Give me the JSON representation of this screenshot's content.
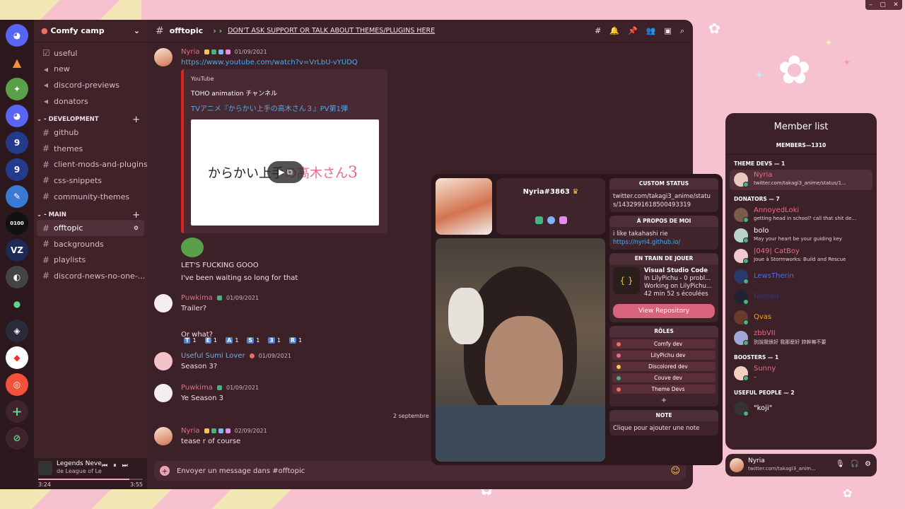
{
  "guild": {
    "name": "Comfy camp"
  },
  "channels_top": [
    "useful",
    "new",
    "discord-previews",
    "donators"
  ],
  "category_dev": "- DEVELOPMENT",
  "channels_dev": [
    "github",
    "themes",
    "client-mods-and-plugins",
    "css-snippets",
    "community-themes"
  ],
  "category_main": "- MAIN",
  "channels_main": [
    "offtopic",
    "backgrounds",
    "playlists",
    "discord-news-no-one-..."
  ],
  "player": {
    "title": "Legends Neve",
    "artist": "de League of Le",
    "elapsed": "3:24",
    "total": "3:55",
    "progress": 0.87
  },
  "chat": {
    "channel": "offtopic",
    "topic": "DON'T ASK SUPPORT OR TALK ABOUT THEMES/PLUGINS HERE",
    "input_placeholder": "Envoyer un message dans #offtopic",
    "date_divider": "2 septembre 20"
  },
  "messages": [
    {
      "author": "Nyria",
      "color": "#e86a8a",
      "time": "01/09/2021",
      "text": "https://www.youtube.com/watch?v=VrLbU-vYUDQ"
    },
    {
      "author": "",
      "color": "#ffffff",
      "time": "",
      "text": "LET'S FUCKING GOOO"
    },
    {
      "author": "",
      "color": "#ffffff",
      "time": "",
      "text": "I've been waiting so long for that"
    },
    {
      "author": "Puwkima",
      "color": "#e86a8a",
      "time": "01/09/2021",
      "text": "Trailer?"
    },
    {
      "author": "",
      "color": "#ffffff",
      "time": "",
      "text": "Or what?"
    },
    {
      "author": "Useful Sumi Lover",
      "color": "#6ab0e8",
      "time": "01/09/2021",
      "text": "Season 3?"
    },
    {
      "author": "Puwkima",
      "color": "#e86a8a",
      "time": "01/09/2021",
      "text": "Ye Season 3"
    },
    {
      "author": "Nyria",
      "color": "#e86a8a",
      "time": "02/09/2021",
      "text": "tease r of course"
    }
  ],
  "embed": {
    "provider": "YouTube",
    "author": "TOHO animation チャンネル",
    "title": "TVアニメ『からかい上手の高木さん３』PV第1弾",
    "thumb_text_a": "からかい上手",
    "thumb_text_b": "の高木さん",
    "thumb_text_c": "3"
  },
  "reactions": [
    {
      "key": "T",
      "count": "1"
    },
    {
      "key": "E",
      "count": "1"
    },
    {
      "key": "A",
      "count": "1"
    },
    {
      "key": "S",
      "count": "1"
    },
    {
      "key": "3",
      "count": "1"
    },
    {
      "key": "R",
      "count": "1"
    }
  ],
  "profile": {
    "tag": "Nyria#3863",
    "custom_status_h": "CUSTOM STATUS",
    "custom_status": "twitter.com/takagi3_anime/status/1432991618500493319",
    "about_h": "À PROPOS DE MOI",
    "about": "i like takahashi rie",
    "about_link": "https://nyri4.github.io/",
    "playing_h": "EN TRAIN DE JOUER",
    "activity_name": "Visual Studio Code",
    "activity_l1": "In LilyPichu - 0 probl...",
    "activity_l2": "Working on LilyPichu...",
    "activity_l3": "42 min 52 s écoulées",
    "repo_btn": "View Repository",
    "roles_h": "RÔLES",
    "roles": [
      {
        "name": "Comfy dev",
        "color": "#f26b6b"
      },
      {
        "name": "LilyPichu dev",
        "color": "#e86a8a"
      },
      {
        "name": "Discolored dev",
        "color": "#f2c94c"
      },
      {
        "name": "Couve dev",
        "color": "#43b581"
      },
      {
        "name": "Theme Devs",
        "color": "#f26b6b"
      }
    ],
    "roles_add": "+",
    "note_h": "NOTE",
    "note": "Clique pour ajouter une note"
  },
  "members": {
    "title": "Member list",
    "count": "MEMBERS—1310",
    "groups": [
      {
        "name": "THEME DEVS — 1",
        "items": [
          {
            "name": "Nyria",
            "color": "#e86a8a",
            "status": "twitter.com/takagi3_anime/status/1..."
          }
        ]
      },
      {
        "name": "DONATORS — 7",
        "items": [
          {
            "name": "AnnoyedLoki",
            "color": "#e86a8a",
            "status": "getting head in school? call that shit de..."
          },
          {
            "name": "bolo",
            "color": "#ffffff",
            "status": "May your heart be your guiding key"
          },
          {
            "name": "|049| CatBoy",
            "color": "#e86a8a",
            "status": "Joue à Stormworks: Build and Rescue"
          },
          {
            "name": "LewsTherin",
            "color": "#4a6de8",
            "status": ""
          },
          {
            "name": "Nomad",
            "color": "#3c2f7a",
            "status": ""
          },
          {
            "name": "Qvas",
            "color": "#f2a22a",
            "status": ""
          },
          {
            "name": "zbbVII",
            "color": "#e86a8a",
            "status": "別說我很好 我那麼好 妳幹嘛不要"
          }
        ]
      },
      {
        "name": "BOOSTERS — 1",
        "items": [
          {
            "name": "Sunny",
            "color": "#e86a8a",
            "status": "–"
          }
        ]
      },
      {
        "name": "USEFUL PEOPLE — 2",
        "items": [
          {
            "name": "\"koji\"",
            "color": "#ffffff",
            "status": ""
          }
        ]
      }
    ]
  },
  "user": {
    "name": "Nyria",
    "status": "twitter.com/takagi3_anim..."
  }
}
